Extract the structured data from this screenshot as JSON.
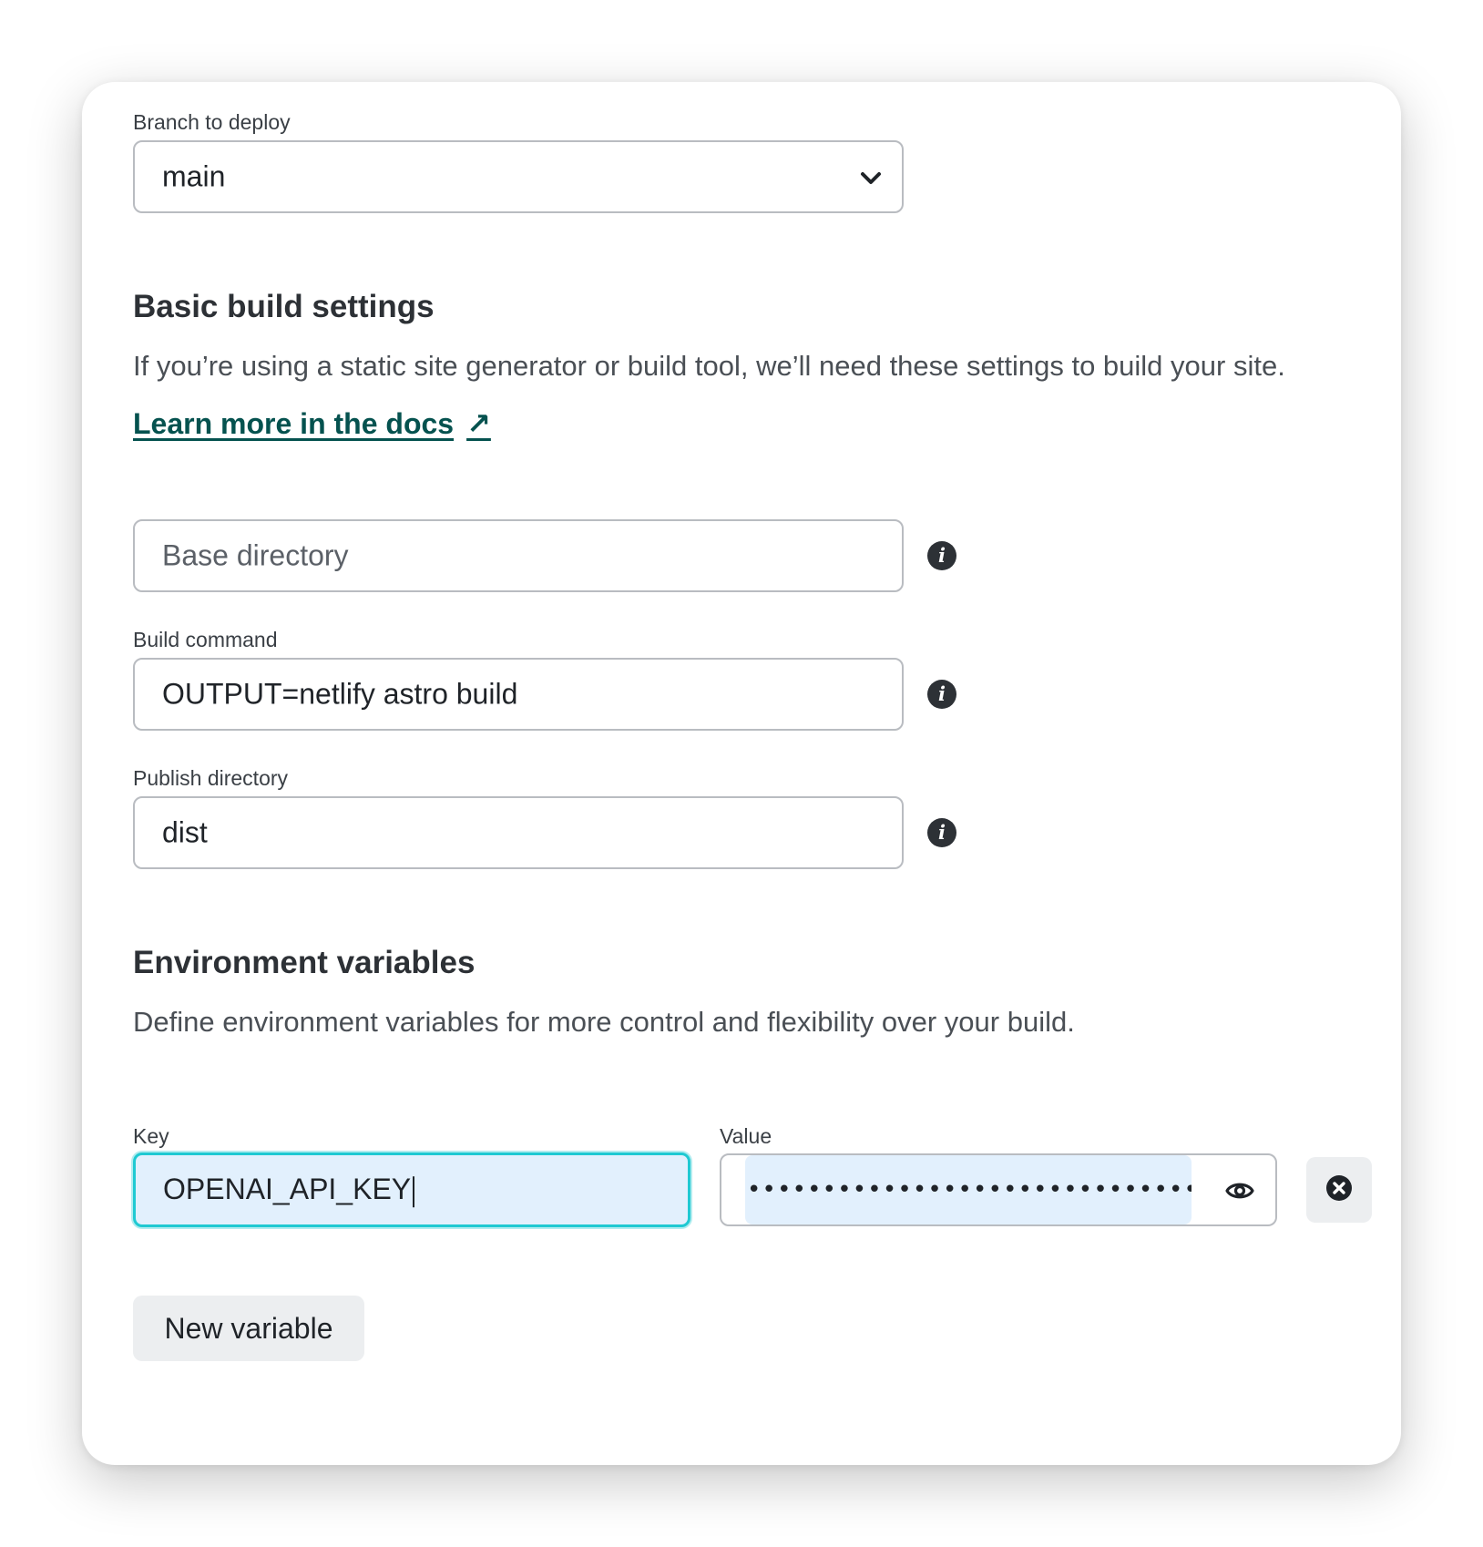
{
  "branch": {
    "label": "Branch to deploy",
    "value": "main"
  },
  "basic_build": {
    "title": "Basic build settings",
    "description": "If you’re using a static site generator or build tool, we’ll need these settings to build your site.",
    "docs_link": "Learn more in the docs",
    "docs_link_arrow": "↗"
  },
  "base_directory": {
    "placeholder": "Base directory"
  },
  "build_command": {
    "label": "Build command",
    "value": "OUTPUT=netlify astro build"
  },
  "publish_directory": {
    "label": "Publish directory",
    "value": "dist"
  },
  "env": {
    "title": "Environment variables",
    "description": "Define environment variables for more control and flexibility over your build.",
    "key_label": "Key",
    "value_label": "Value",
    "key_value": "OPENAI_API_KEY",
    "masked_value": "••••••••••••••••••••••••••••••••••",
    "new_variable_label": "New variable"
  },
  "icons": {
    "info": "i",
    "chevron": "chevron-down-icon",
    "eye": "eye-icon",
    "remove": "close-circle-icon"
  },
  "colors": {
    "link": "#05524f",
    "focus_ring": "#1fc9d2",
    "input_fill": "#e2f0fd"
  }
}
